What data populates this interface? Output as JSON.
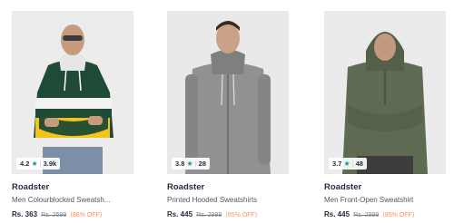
{
  "products": [
    {
      "rating": "4.2",
      "rating_count": "3.9k",
      "brand": "Roadster",
      "title": "Men Colourblocked Sweatsh...",
      "price": "Rs. 363",
      "mrp": "Rs. 2599",
      "discount": "(86% OFF)"
    },
    {
      "rating": "3.8",
      "rating_count": "28",
      "brand": "Roadster",
      "title": "Printed Hooded Sweatshirts",
      "price": "Rs. 445",
      "mrp": "Rs. 2999",
      "discount": "(85% OFF)"
    },
    {
      "rating": "3.7",
      "rating_count": "48",
      "brand": "Roadster",
      "title": "Men Front-Open Sweatshirt",
      "price": "Rs. 445",
      "mrp": "Rs. 2999",
      "discount": "(85% OFF)"
    }
  ],
  "icons": {
    "rating_star": "star-icon"
  },
  "colors": {
    "rating_star": "#14958f",
    "discount": "#ff905a",
    "text_primary": "#282c3f"
  },
  "star_glyph": "★",
  "separator": "|"
}
